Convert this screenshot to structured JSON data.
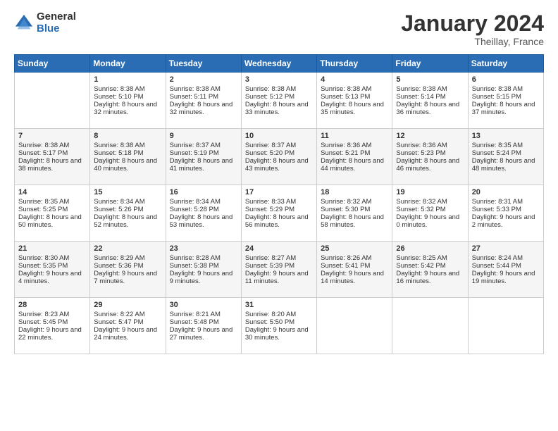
{
  "header": {
    "logo_general": "General",
    "logo_blue": "Blue",
    "month_title": "January 2024",
    "location": "Theillay, France"
  },
  "days_of_week": [
    "Sunday",
    "Monday",
    "Tuesday",
    "Wednesday",
    "Thursday",
    "Friday",
    "Saturday"
  ],
  "weeks": [
    [
      {
        "day": "",
        "sunrise": "",
        "sunset": "",
        "daylight": ""
      },
      {
        "day": "1",
        "sunrise": "Sunrise: 8:38 AM",
        "sunset": "Sunset: 5:10 PM",
        "daylight": "Daylight: 8 hours and 32 minutes."
      },
      {
        "day": "2",
        "sunrise": "Sunrise: 8:38 AM",
        "sunset": "Sunset: 5:11 PM",
        "daylight": "Daylight: 8 hours and 32 minutes."
      },
      {
        "day": "3",
        "sunrise": "Sunrise: 8:38 AM",
        "sunset": "Sunset: 5:12 PM",
        "daylight": "Daylight: 8 hours and 33 minutes."
      },
      {
        "day": "4",
        "sunrise": "Sunrise: 8:38 AM",
        "sunset": "Sunset: 5:13 PM",
        "daylight": "Daylight: 8 hours and 35 minutes."
      },
      {
        "day": "5",
        "sunrise": "Sunrise: 8:38 AM",
        "sunset": "Sunset: 5:14 PM",
        "daylight": "Daylight: 8 hours and 36 minutes."
      },
      {
        "day": "6",
        "sunrise": "Sunrise: 8:38 AM",
        "sunset": "Sunset: 5:15 PM",
        "daylight": "Daylight: 8 hours and 37 minutes."
      }
    ],
    [
      {
        "day": "7",
        "sunrise": "Sunrise: 8:38 AM",
        "sunset": "Sunset: 5:17 PM",
        "daylight": "Daylight: 8 hours and 38 minutes."
      },
      {
        "day": "8",
        "sunrise": "Sunrise: 8:38 AM",
        "sunset": "Sunset: 5:18 PM",
        "daylight": "Daylight: 8 hours and 40 minutes."
      },
      {
        "day": "9",
        "sunrise": "Sunrise: 8:37 AM",
        "sunset": "Sunset: 5:19 PM",
        "daylight": "Daylight: 8 hours and 41 minutes."
      },
      {
        "day": "10",
        "sunrise": "Sunrise: 8:37 AM",
        "sunset": "Sunset: 5:20 PM",
        "daylight": "Daylight: 8 hours and 43 minutes."
      },
      {
        "day": "11",
        "sunrise": "Sunrise: 8:36 AM",
        "sunset": "Sunset: 5:21 PM",
        "daylight": "Daylight: 8 hours and 44 minutes."
      },
      {
        "day": "12",
        "sunrise": "Sunrise: 8:36 AM",
        "sunset": "Sunset: 5:23 PM",
        "daylight": "Daylight: 8 hours and 46 minutes."
      },
      {
        "day": "13",
        "sunrise": "Sunrise: 8:35 AM",
        "sunset": "Sunset: 5:24 PM",
        "daylight": "Daylight: 8 hours and 48 minutes."
      }
    ],
    [
      {
        "day": "14",
        "sunrise": "Sunrise: 8:35 AM",
        "sunset": "Sunset: 5:25 PM",
        "daylight": "Daylight: 8 hours and 50 minutes."
      },
      {
        "day": "15",
        "sunrise": "Sunrise: 8:34 AM",
        "sunset": "Sunset: 5:26 PM",
        "daylight": "Daylight: 8 hours and 52 minutes."
      },
      {
        "day": "16",
        "sunrise": "Sunrise: 8:34 AM",
        "sunset": "Sunset: 5:28 PM",
        "daylight": "Daylight: 8 hours and 53 minutes."
      },
      {
        "day": "17",
        "sunrise": "Sunrise: 8:33 AM",
        "sunset": "Sunset: 5:29 PM",
        "daylight": "Daylight: 8 hours and 56 minutes."
      },
      {
        "day": "18",
        "sunrise": "Sunrise: 8:32 AM",
        "sunset": "Sunset: 5:30 PM",
        "daylight": "Daylight: 8 hours and 58 minutes."
      },
      {
        "day": "19",
        "sunrise": "Sunrise: 8:32 AM",
        "sunset": "Sunset: 5:32 PM",
        "daylight": "Daylight: 9 hours and 0 minutes."
      },
      {
        "day": "20",
        "sunrise": "Sunrise: 8:31 AM",
        "sunset": "Sunset: 5:33 PM",
        "daylight": "Daylight: 9 hours and 2 minutes."
      }
    ],
    [
      {
        "day": "21",
        "sunrise": "Sunrise: 8:30 AM",
        "sunset": "Sunset: 5:35 PM",
        "daylight": "Daylight: 9 hours and 4 minutes."
      },
      {
        "day": "22",
        "sunrise": "Sunrise: 8:29 AM",
        "sunset": "Sunset: 5:36 PM",
        "daylight": "Daylight: 9 hours and 7 minutes."
      },
      {
        "day": "23",
        "sunrise": "Sunrise: 8:28 AM",
        "sunset": "Sunset: 5:38 PM",
        "daylight": "Daylight: 9 hours and 9 minutes."
      },
      {
        "day": "24",
        "sunrise": "Sunrise: 8:27 AM",
        "sunset": "Sunset: 5:39 PM",
        "daylight": "Daylight: 9 hours and 11 minutes."
      },
      {
        "day": "25",
        "sunrise": "Sunrise: 8:26 AM",
        "sunset": "Sunset: 5:41 PM",
        "daylight": "Daylight: 9 hours and 14 minutes."
      },
      {
        "day": "26",
        "sunrise": "Sunrise: 8:25 AM",
        "sunset": "Sunset: 5:42 PM",
        "daylight": "Daylight: 9 hours and 16 minutes."
      },
      {
        "day": "27",
        "sunrise": "Sunrise: 8:24 AM",
        "sunset": "Sunset: 5:44 PM",
        "daylight": "Daylight: 9 hours and 19 minutes."
      }
    ],
    [
      {
        "day": "28",
        "sunrise": "Sunrise: 8:23 AM",
        "sunset": "Sunset: 5:45 PM",
        "daylight": "Daylight: 9 hours and 22 minutes."
      },
      {
        "day": "29",
        "sunrise": "Sunrise: 8:22 AM",
        "sunset": "Sunset: 5:47 PM",
        "daylight": "Daylight: 9 hours and 24 minutes."
      },
      {
        "day": "30",
        "sunrise": "Sunrise: 8:21 AM",
        "sunset": "Sunset: 5:48 PM",
        "daylight": "Daylight: 9 hours and 27 minutes."
      },
      {
        "day": "31",
        "sunrise": "Sunrise: 8:20 AM",
        "sunset": "Sunset: 5:50 PM",
        "daylight": "Daylight: 9 hours and 30 minutes."
      },
      {
        "day": "",
        "sunrise": "",
        "sunset": "",
        "daylight": ""
      },
      {
        "day": "",
        "sunrise": "",
        "sunset": "",
        "daylight": ""
      },
      {
        "day": "",
        "sunrise": "",
        "sunset": "",
        "daylight": ""
      }
    ]
  ]
}
